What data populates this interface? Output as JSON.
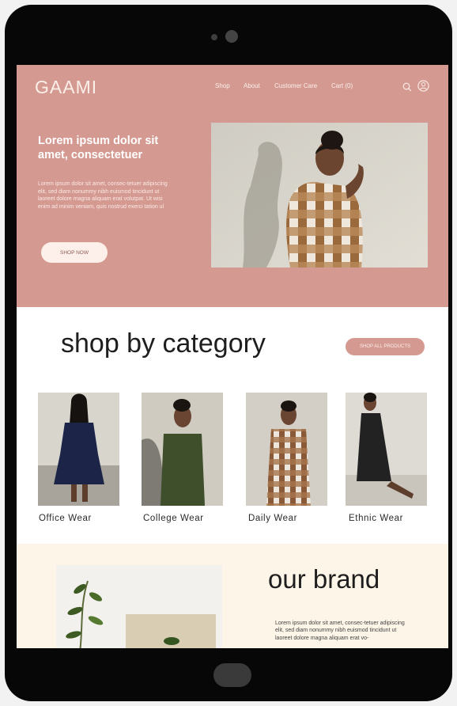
{
  "brand": {
    "logo": "GAAMI"
  },
  "nav": {
    "items": [
      "Shop",
      "About",
      "Customer Care",
      "Cart (0)"
    ]
  },
  "icons": [
    "search-icon",
    "account-icon"
  ],
  "hero": {
    "title": "Lorem ipsum dolor sit amet, consectetuer",
    "body": "Lorem ipsum dolor sit amet, consec-tetuer adipiscing elit, sed diam nonummy nibh euismod tincidunt ut laoreet dolore magna aliquam erat volutpat. Ut wisi enim ad minim veniam, quis nostrud exerci tation ul",
    "cta": "SHOP NOW"
  },
  "category": {
    "title": "shop by category",
    "cta": "SHOP ALL PRODUCTS",
    "items": [
      "Office Wear",
      "College Wear",
      "Daily Wear",
      "Ethnic Wear"
    ]
  },
  "about": {
    "title": "our brand",
    "body": "Lorem ipsum dolor sit amet, consec-tetuer adipiscing elit, sed diam nonummy nibh euismod tincidunt ut laoreet dolore magna aliquam erat vo-"
  },
  "colors": {
    "accent": "#d49a91",
    "cream": "#fdf5e7",
    "device": "#070707"
  }
}
